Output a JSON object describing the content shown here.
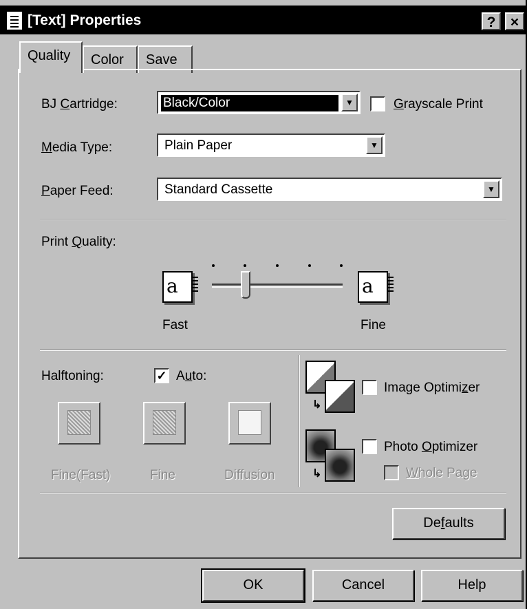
{
  "window": {
    "title": "[Text] Properties",
    "help_button": "?",
    "close_button": "×"
  },
  "tabs": [
    {
      "label": "Quality",
      "active": true
    },
    {
      "label": "Color",
      "active": false
    },
    {
      "label": "Save",
      "active": false
    }
  ],
  "quality": {
    "bj_cartridge": {
      "label_pre": "BJ ",
      "label_key": "C",
      "label_post": "artridge:",
      "value": "Black/Color"
    },
    "grayscale": {
      "label_key": "G",
      "label_post": "rayscale Print",
      "checked": false
    },
    "media_type": {
      "label_key": "M",
      "label_post": "edia Type:",
      "value": "Plain Paper"
    },
    "paper_feed": {
      "label_key": "P",
      "label_post": "aper Feed:",
      "value": "Standard Cassette"
    },
    "print_quality": {
      "label_pre": "Print ",
      "label_key": "Q",
      "label_post": "uality:",
      "left_label": "Fast",
      "right_label": "Fine",
      "icon_glyph": "a",
      "level": 2,
      "levels": 5
    },
    "halftoning": {
      "label": "Halftoning:",
      "auto": {
        "label_pre": "A",
        "label_key": "u",
        "label_post": "to:",
        "checked": true
      },
      "options": [
        "Fine(Fast)",
        "Fine",
        "Diffusion"
      ]
    },
    "image_optimizer": {
      "label_pre": "Image Optimi",
      "label_key": "z",
      "label_post": "er",
      "checked": false
    },
    "photo_optimizer": {
      "label_pre": "Photo ",
      "label_key": "O",
      "label_post": "ptimizer",
      "checked": false
    },
    "whole_page": {
      "label_key": "W",
      "label_post": "hole Page",
      "checked": false,
      "enabled": false
    },
    "defaults_button": {
      "label_pre": "De",
      "label_key": "f",
      "label_post": "aults"
    }
  },
  "footer": {
    "ok": "OK",
    "cancel": "Cancel",
    "help": "Help"
  },
  "check_mark": "✓",
  "dropdown_arrow": "▼"
}
